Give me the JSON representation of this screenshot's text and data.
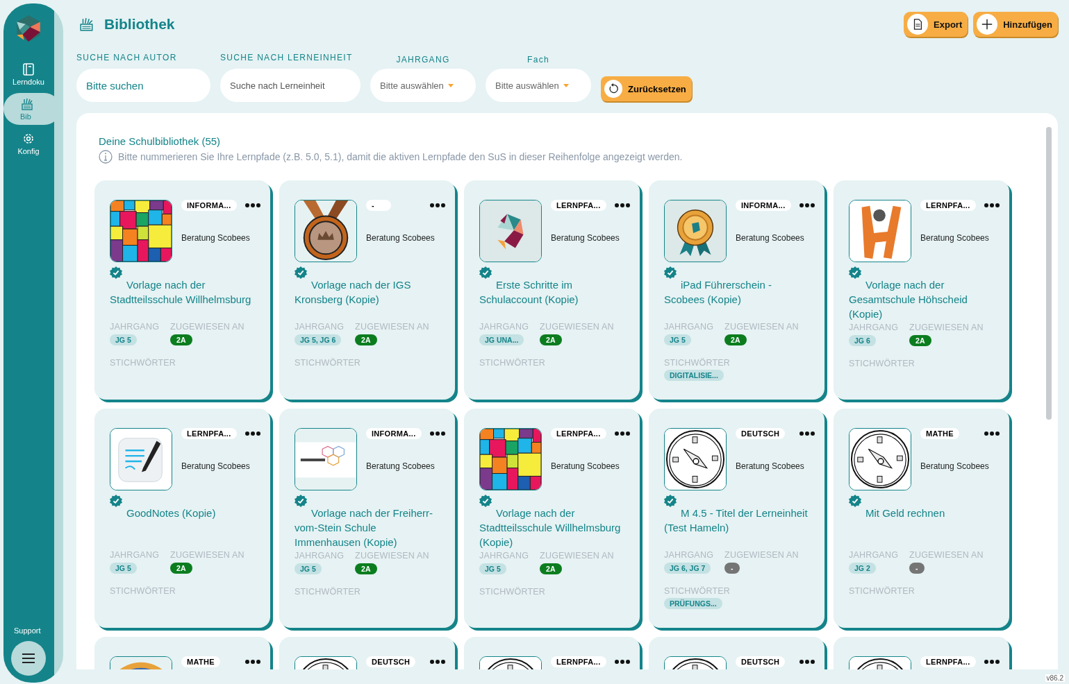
{
  "sidebar": {
    "items": [
      {
        "label": "Lerndoku",
        "selected": false
      },
      {
        "label": "Bib",
        "selected": true
      },
      {
        "label": "Konfig",
        "selected": false
      }
    ],
    "support": "Support"
  },
  "header": {
    "title": "Bibliothek",
    "buttons": [
      "Export",
      "Hinzufügen"
    ]
  },
  "filters": [
    {
      "label": "SUCHE NACH AUTOR",
      "kind": "search",
      "placeholder": "Bitte suchen"
    },
    {
      "label": "SUCHE NACH LERNEINHEIT",
      "kind": "search",
      "placeholder": "Suche nach Lerneinheit"
    },
    {
      "label": "JAHRGANG",
      "kind": "select",
      "placeholder": "Bitte auswählen"
    },
    {
      "label": "Fach",
      "kind": "select",
      "placeholder": "Bitte auswählen"
    }
  ],
  "reset": "Zurücksetzen",
  "library": {
    "heading": "Deine Schulbibliothek (55)",
    "hint": "Bitte nummerieren Sie Ihre Lernpfade (z.B. 5.0, 5.1), damit die aktiven Lernpfade den SuS in dieser Reihenfolge angezeigt werden.",
    "cards": [
      {
        "tag": "INFORMA...",
        "author": "Beratung Scobees",
        "title": "Vorlage nach der Stadtteilsschule Willhelmsburg",
        "grade_label": "JAHRGANG",
        "grade": "JG 5",
        "assigned_label": "ZUGEWIESEN AN",
        "assigned": "2A",
        "color": "#0b7d1f",
        "keywords_label": "STICHWÖRTER"
      },
      {
        "tag": "-",
        "author": "Beratung Scobees",
        "title": "Vorlage nach der IGS Kronsberg (Kopie)",
        "grade_label": "JAHRGANG",
        "grade": "JG 5, JG 6",
        "assigned_label": "ZUGEWIESEN AN",
        "assigned": "2A",
        "color": "#0b7d1f",
        "keywords_label": "STICHWÖRTER"
      },
      {
        "tag": "LERNPFA...",
        "author": "Beratung Scobees",
        "title": "Erste Schritte im Schulaccount (Kopie)",
        "grade_label": "JAHRGANG",
        "grade": "JG UNA...",
        "assigned_label": "ZUGEWIESEN AN",
        "assigned": "2A",
        "color": "#0b7d1f",
        "keywords_label": "STICHWÖRTER"
      },
      {
        "tag": "INFORMA...",
        "author": "Beratung Scobees",
        "title": "iPad Führerschein - Scobees (Kopie)",
        "grade_label": "JAHRGANG",
        "grade": "JG 5",
        "assigned_label": "ZUGEWIESEN AN",
        "assigned": "2A",
        "color": "#0b7d1f",
        "keywords_label": "STICHWÖRTER",
        "keywords": [
          "DIGITALISIE..."
        ]
      },
      {
        "tag": "LERNPFA...",
        "author": "Beratung Scobees",
        "title": "Vorlage nach der Gesamtschule Höhscheid (Kopie)",
        "grade_label": "JAHRGANG",
        "grade": "JG 6",
        "assigned_label": "ZUGEWIESEN AN",
        "assigned": "2A",
        "color": "#0b7d1f",
        "keywords_label": "STICHWÖRTER"
      },
      {
        "tag": "LERNPFA...",
        "author": "Beratung Scobees",
        "title": "GoodNotes (Kopie)",
        "grade_label": "JAHRGANG",
        "grade": "JG 5",
        "assigned_label": "ZUGEWIESEN AN",
        "assigned": "2A",
        "color": "#0b7d1f",
        "keywords_label": "STICHWÖRTER"
      },
      {
        "tag": "INFORMA...",
        "author": "Beratung Scobees",
        "title": "Vorlage nach der Freiherr-vom-Stein Schule Immenhausen (Kopie)",
        "grade_label": "JAHRGANG",
        "grade": "JG 5",
        "assigned_label": "ZUGEWIESEN AN",
        "assigned": "2A",
        "color": "#0b7d1f",
        "keywords_label": "STICHWÖRTER"
      },
      {
        "tag": "LERNPFA...",
        "author": "Beratung Scobees",
        "title": "Vorlage nach der Stadtteilsschule Willhelmsburg (Kopie)",
        "grade_label": "JAHRGANG",
        "grade": "JG 5",
        "assigned_label": "ZUGEWIESEN AN",
        "assigned": "2A",
        "color": "#0b7d1f",
        "keywords_label": "STICHWÖRTER"
      },
      {
        "tag": "DEUTSCH",
        "author": "Beratung Scobees",
        "title": "M 4.5 - Titel der Lerneinheit (Test Hameln)",
        "grade_label": "JAHRGANG",
        "grade": "JG 6, JG 7",
        "assigned_label": "ZUGEWIESEN AN",
        "assigned": "-",
        "color": "#757575",
        "keywords_label": "STICHWÖRTER",
        "keywords": [
          "PRÜFUNGS..."
        ]
      },
      {
        "tag": "MATHE",
        "author": "Beratung Scobees",
        "title": "Mit Geld rechnen",
        "grade_label": "JAHRGANG",
        "grade": "JG 2",
        "assigned_label": "ZUGEWIESEN AN",
        "assigned": "-",
        "color": "#757575",
        "keywords_label": "STICHWÖRTER"
      },
      {
        "tag": "MATHE"
      },
      {
        "tag": "DEUTSCH"
      },
      {
        "tag": "LERNPFA..."
      },
      {
        "tag": "DEUTSCH"
      },
      {
        "tag": "LERNPFA..."
      }
    ]
  },
  "version": "v86.2"
}
